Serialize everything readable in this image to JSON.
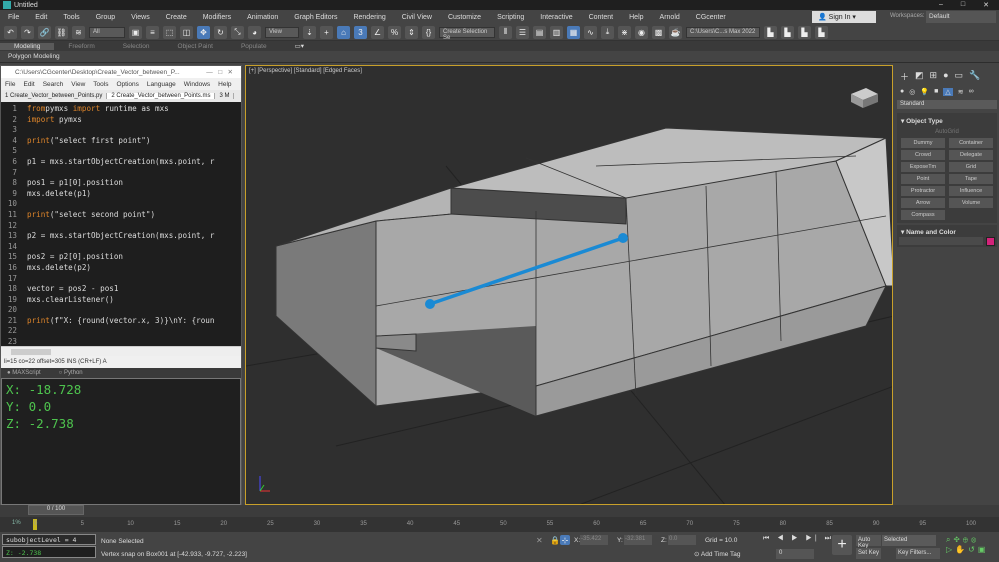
{
  "window": {
    "title": "Untitled",
    "controls": [
      "–",
      "□",
      "✕"
    ]
  },
  "menu": [
    "File",
    "Edit",
    "Tools",
    "Group",
    "Views",
    "Create",
    "Modifiers",
    "Animation",
    "Graph Editors",
    "Rendering",
    "Civil View",
    "Customize",
    "Scripting",
    "Interactive",
    "Content",
    "Help",
    "Arnold",
    "CGcenter"
  ],
  "account": {
    "sign_in": "Sign In",
    "workspaces_label": "Workspaces:",
    "workspace": "Default"
  },
  "toolbar": {
    "selection_filter": "All",
    "ref_coord": "View",
    "named_selection": "Create Selection Se",
    "project_path": "C:\\Users\\C...s Max 2022"
  },
  "ribbon": {
    "tabs": [
      "Modeling",
      "Freeform",
      "Selection",
      "Object Paint",
      "Populate"
    ],
    "active": "Modeling",
    "sub": "Polygon Modeling"
  },
  "editor": {
    "title": "C:\\Users\\CGcenter\\Desktop\\Create_Vector_between_P...",
    "menu": [
      "File",
      "Edit",
      "Search",
      "View",
      "Tools",
      "Options",
      "Language",
      "Windows",
      "Help"
    ],
    "tabs": [
      "1 Create_Vector_between_Points.py",
      "2 Create_Vector_between_Points.ms",
      "3 M"
    ],
    "lines": [
      {
        "n": "1",
        "parts": [
          [
            "kw",
            "from"
          ],
          [
            "",
            "pymxs "
          ],
          [
            "kw",
            "import"
          ],
          [
            "",
            " runtime as mxs"
          ]
        ]
      },
      {
        "n": "2",
        "parts": [
          [
            "kw",
            "import"
          ],
          [
            "",
            " pymxs"
          ]
        ]
      },
      {
        "n": "3",
        "parts": []
      },
      {
        "n": "4",
        "parts": [
          [
            "kw",
            "print"
          ],
          [
            "",
            "(\"select first point\")"
          ]
        ]
      },
      {
        "n": "5",
        "parts": []
      },
      {
        "n": "6",
        "parts": [
          [
            "",
            "p1 = mxs.startObjectCreation(mxs.point, r"
          ]
        ]
      },
      {
        "n": "7",
        "parts": []
      },
      {
        "n": "8",
        "parts": [
          [
            "",
            "pos1 = p1[0].position"
          ]
        ]
      },
      {
        "n": "9",
        "parts": [
          [
            "",
            "mxs.delete(p1)"
          ]
        ]
      },
      {
        "n": "10",
        "parts": []
      },
      {
        "n": "11",
        "parts": [
          [
            "kw",
            "print"
          ],
          [
            "",
            "(\"select second point\")"
          ]
        ]
      },
      {
        "n": "12",
        "parts": []
      },
      {
        "n": "13",
        "parts": [
          [
            "",
            "p2 = mxs.startObjectCreation(mxs.point, r"
          ]
        ]
      },
      {
        "n": "14",
        "parts": []
      },
      {
        "n": "15",
        "parts": [
          [
            "",
            "pos2 = p2[0].position"
          ]
        ]
      },
      {
        "n": "16",
        "parts": [
          [
            "",
            "mxs.delete(p2)"
          ]
        ]
      },
      {
        "n": "17",
        "parts": []
      },
      {
        "n": "18",
        "parts": [
          [
            "",
            "vector = pos2 - pos1"
          ]
        ]
      },
      {
        "n": "19",
        "parts": [
          [
            "",
            "mxs.clearListener()"
          ]
        ]
      },
      {
        "n": "20",
        "parts": []
      },
      {
        "n": "21",
        "parts": [
          [
            "kw",
            "print"
          ],
          [
            "",
            "(f\"X: {round(vector.x, 3)}\\nY: {roun"
          ]
        ]
      },
      {
        "n": "22",
        "parts": []
      },
      {
        "n": "23",
        "parts": []
      }
    ],
    "status": "li=15 co=22 offset=305 INS (CR+LF) A",
    "lang_options": [
      "MAXScript",
      "Python"
    ],
    "output": [
      "X: -18.728",
      "Y: 0.0",
      "Z: -2.738"
    ]
  },
  "viewport": {
    "label": "[+] [Perspective] [Standard] [Edged Faces]"
  },
  "command_panel": {
    "category": "Standard",
    "object_type_title": "Object Type",
    "autogrid": "AutoGrid",
    "buttons": [
      "Dummy",
      "Container",
      "Crowd",
      "Delegate",
      "ExposeTm",
      "Grid",
      "Point",
      "Tape",
      "Protractor",
      "Influence",
      "Arrow",
      "Volume",
      "Compass"
    ],
    "name_color_title": "Name and Color",
    "object_color": "#d4237a"
  },
  "timeline": {
    "frame": "0 / 100",
    "ticks": [
      "0",
      "5",
      "10",
      "15",
      "20",
      "25",
      "30",
      "35",
      "40",
      "45",
      "50",
      "55",
      "60",
      "65",
      "70",
      "75",
      "80",
      "85",
      "90",
      "95",
      "100"
    ],
    "percent": "1%"
  },
  "status": {
    "mini_listener": "subobjectLevel = 4",
    "mini_output": "Z: -2.738",
    "selection": "None Selected",
    "prompt": "Vertex snap on Box001 at [-42.933, -9.727, -2.223]",
    "x_label": "X:",
    "x": "-35.422",
    "y_label": "Y:",
    "y": "-32.381",
    "z_label": "Z:",
    "z": "0.0",
    "grid": "Grid = 10.0",
    "add_time_tag": "Add Time Tag",
    "current_frame": "0",
    "auto_key": "Auto Key",
    "set_key": "Set Key",
    "key_mode": "Selected",
    "key_filters": "Key Filters..."
  },
  "colors": {
    "accent": "#4a7ab8",
    "line": "#1a8ad4",
    "viewport_border": "#c8a02a"
  }
}
